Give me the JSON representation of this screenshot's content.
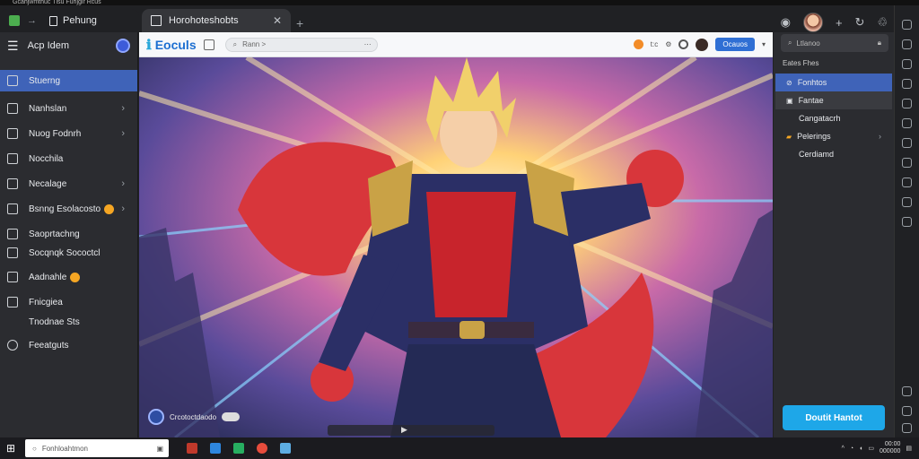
{
  "window": {
    "title_strip": "Gcahjwmthuc Tlsu Fuhjgir Rcus"
  },
  "tabs": [
    {
      "label": "Pehung"
    },
    {
      "label": "Horohoteshobts"
    }
  ],
  "left_sidebar": {
    "header": "Acp Idem",
    "items": [
      {
        "label": "Stuerng",
        "has_chevron": false,
        "selected": true
      },
      {
        "label": "Nanhslan",
        "has_chevron": true,
        "selected": false
      },
      {
        "label": "Nuog Fodnrh",
        "has_chevron": true,
        "selected": false
      },
      {
        "label": "Nocchila",
        "has_chevron": false,
        "selected": false
      },
      {
        "label": "Necalage",
        "has_chevron": true,
        "selected": false
      },
      {
        "label": "Bsnng Esolacosto",
        "has_chevron": true,
        "selected": false,
        "emoji": true
      },
      {
        "label": "Saoprtachng",
        "has_chevron": false,
        "selected": false
      },
      {
        "label": "Socqnqk Sococtcl",
        "has_chevron": false,
        "selected": false
      },
      {
        "label": "Aadnahle",
        "has_chevron": false,
        "selected": false,
        "emoji": true
      },
      {
        "label": "Fnicgiea",
        "has_chevron": false,
        "selected": false
      },
      {
        "label": "Tnodnae Sts",
        "has_chevron": false,
        "selected": false
      },
      {
        "label": "Feeatguts",
        "has_chevron": false,
        "selected": false
      }
    ]
  },
  "toolbar": {
    "brand": "Eoculs",
    "search_placeholder": "Rann >",
    "count": "t:c",
    "button": "Ocauos"
  },
  "hero": {
    "pill_label": "Crcotoctdaodo"
  },
  "right_panel": {
    "search_placeholder": "Ltlanoo",
    "title": "Eates Fhes",
    "items": [
      {
        "label": "Fonhtos",
        "style": "selected"
      },
      {
        "label": "Fantae",
        "style": "hover"
      },
      {
        "label": "Cangatacrh",
        "style": "normal"
      },
      {
        "label": "Pelerings",
        "style": "normal",
        "has_chevron": true
      },
      {
        "label": "Cerdiamd",
        "style": "normal"
      }
    ],
    "cta": "Doutit Hantot"
  },
  "taskbar": {
    "search_placeholder": "Fonhloahtmon",
    "time": "00:00",
    "date": "000000"
  },
  "colors": {
    "accent": "#3f63b8",
    "cta": "#1ea7e8",
    "brand": "#1d6fd1"
  }
}
